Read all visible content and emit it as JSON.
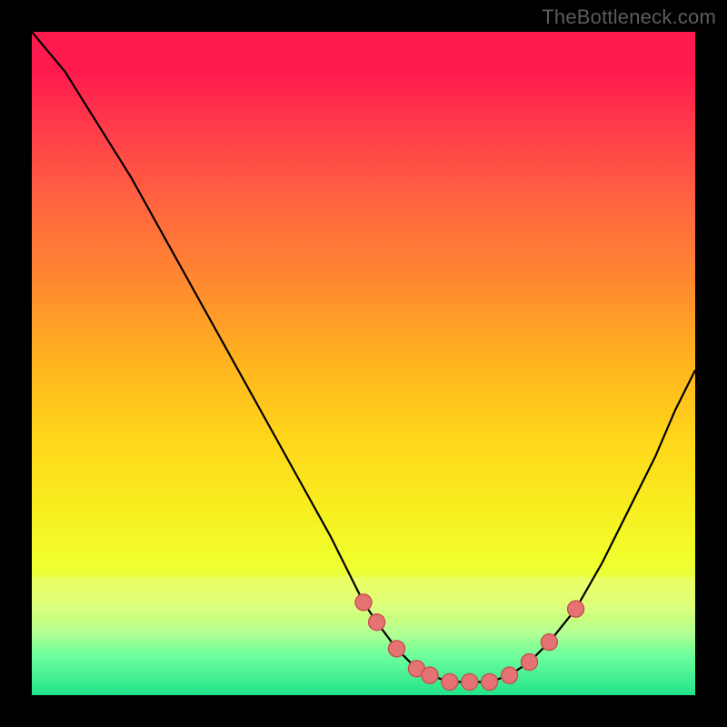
{
  "watermark": "TheBottleneck.com",
  "colors": {
    "background": "#000000",
    "curve": "#000000",
    "dot_fill": "#e57373",
    "dot_stroke": "#c94f4f",
    "gradient_top": "#ff1a4d",
    "gradient_bottom": "#22e38a"
  },
  "chart_data": {
    "type": "line",
    "title": "",
    "xlabel": "",
    "ylabel": "",
    "xlim": [
      0,
      100
    ],
    "ylim": [
      0,
      100
    ],
    "series": [
      {
        "name": "bottleneck-curve",
        "x": [
          0,
          5,
          10,
          15,
          20,
          25,
          30,
          35,
          40,
          45,
          50,
          52,
          55,
          58,
          60,
          63,
          66,
          69,
          72,
          75,
          78,
          82,
          86,
          90,
          94,
          97,
          100
        ],
        "values": [
          100,
          94,
          86,
          78,
          69,
          60,
          51,
          42,
          33,
          24,
          14,
          11,
          7,
          4,
          3,
          2,
          2,
          2,
          3,
          5,
          8,
          13,
          20,
          28,
          36,
          43,
          49
        ]
      }
    ],
    "highlight_points": {
      "name": "sweet-spot-dots",
      "x": [
        50,
        52,
        55,
        58,
        60,
        63,
        66,
        69,
        72,
        75,
        78,
        82
      ],
      "values": [
        14,
        11,
        7,
        4,
        3,
        2,
        2,
        2,
        3,
        5,
        8,
        13
      ]
    }
  }
}
